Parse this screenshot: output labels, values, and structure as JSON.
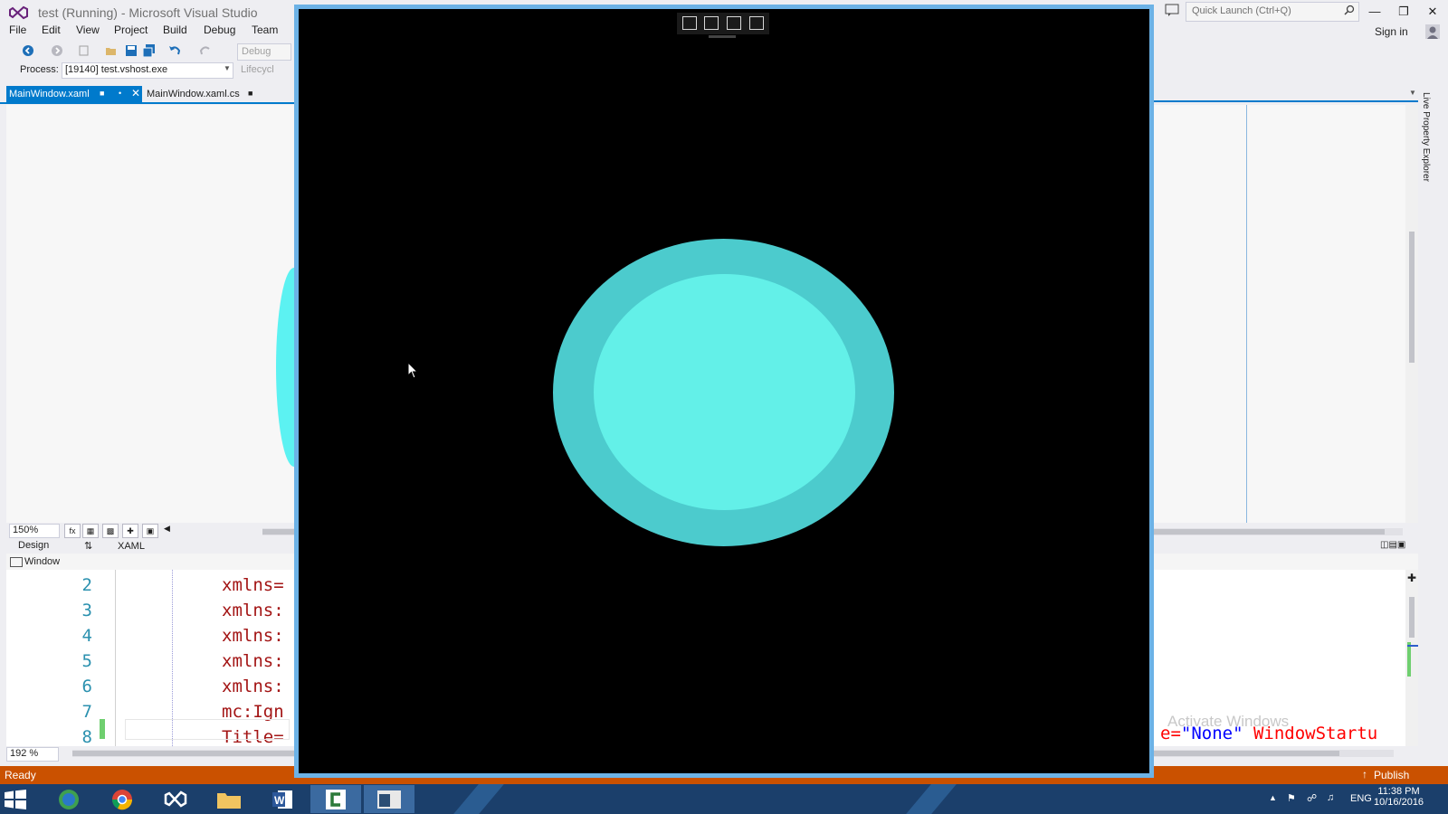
{
  "window": {
    "title": "test (Running) - Microsoft Visual Studio",
    "quick_launch_placeholder": "Quick Launch (Ctrl+Q)",
    "sign_in": "Sign in"
  },
  "menu": [
    "File",
    "Edit",
    "View",
    "Project",
    "Build",
    "Debug",
    "Team"
  ],
  "toolbar": {
    "config": "Debug",
    "process_label": "Process:",
    "process_value": "[19140] test.vshost.exe",
    "lifecycle": "Lifecycl"
  },
  "tabs": [
    {
      "label": "MainWindow.xaml",
      "active": true
    },
    {
      "label": "MainWindow.xaml.cs",
      "active": false
    }
  ],
  "designer": {
    "zoom": "150%",
    "design_tab": "Design",
    "xaml_tab": "XAML",
    "window_combo": "Window",
    "fx_label": "fx"
  },
  "code": {
    "lines": [
      {
        "num": "2",
        "text": "xmlns="
      },
      {
        "num": "3",
        "text": "xmlns:"
      },
      {
        "num": "4",
        "text": "xmlns:"
      },
      {
        "num": "5",
        "text": "xmlns:"
      },
      {
        "num": "6",
        "text": "xmlns:"
      },
      {
        "num": "7",
        "text": "mc:Ign"
      },
      {
        "num": "8",
        "text": "Title="
      }
    ],
    "right_fragment_attr": "e=",
    "right_fragment_value": "\"None\"",
    "right_fragment_tail": " WindowStartu",
    "zoom": "192 %",
    "watermark": "Activate Windows"
  },
  "statusbar": {
    "left": "Ready",
    "publish": "Publish"
  },
  "side_panel": {
    "label": "Live Property Explorer"
  },
  "taskbar": {
    "lang": "ENG",
    "time": "11:38 PM",
    "date": "10/16/2016"
  },
  "running_app": {
    "outer_color": "#4ccbcd",
    "inner_color": "#63f0e8",
    "background": "#000000"
  },
  "colors": {
    "accent": "#007acc",
    "status_bar": "#ca5100",
    "taskbar": "#1b3f6b"
  }
}
